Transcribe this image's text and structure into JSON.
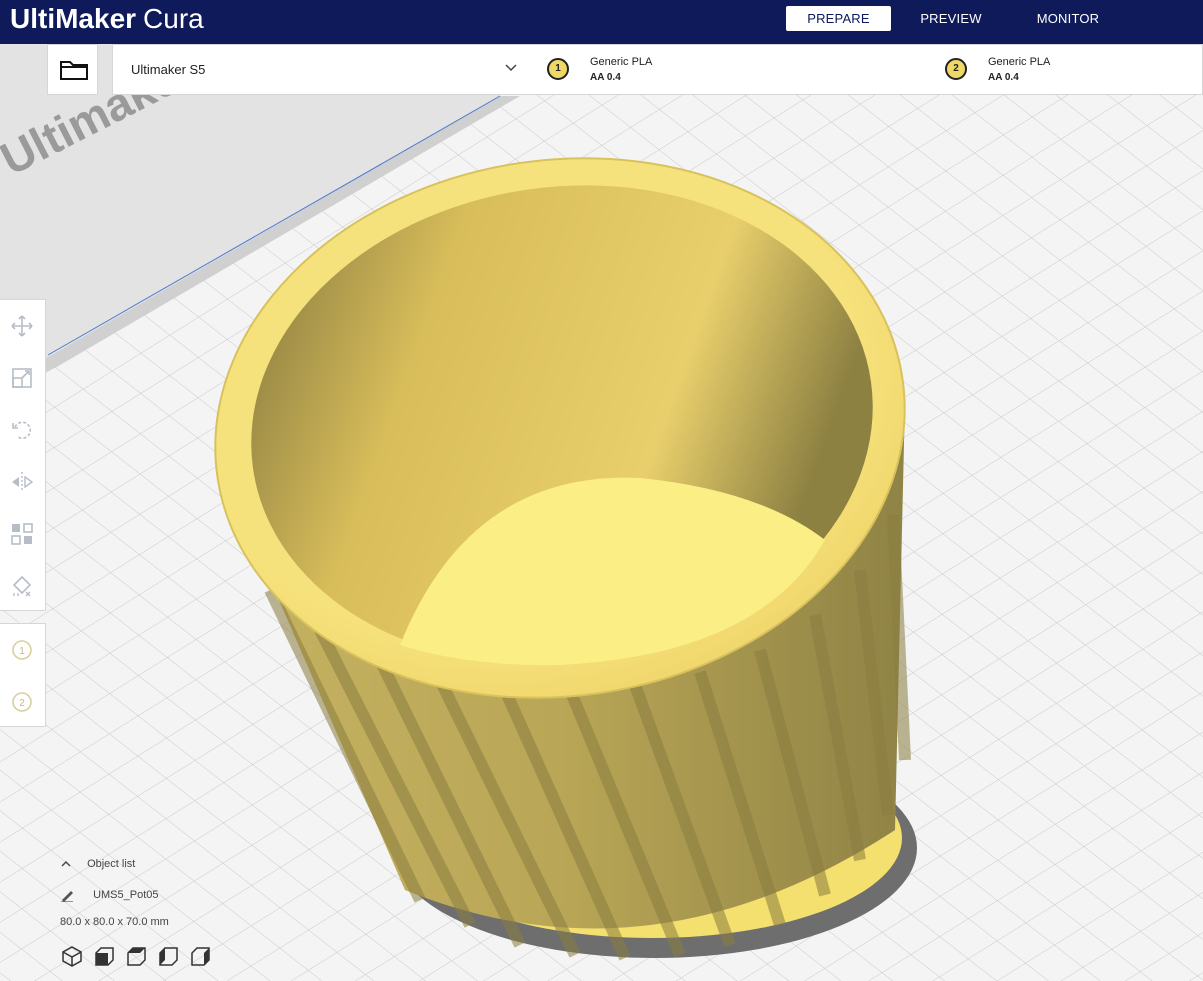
{
  "app": {
    "brand_bold": "UltiMaker",
    "brand_light": "Cura"
  },
  "tabs": [
    {
      "label": "PREPARE",
      "active": true
    },
    {
      "label": "PREVIEW",
      "active": false
    },
    {
      "label": "MONITOR",
      "active": false
    }
  ],
  "printer": {
    "name": "Ultimaker S5"
  },
  "extruders": [
    {
      "number": "1",
      "material": "Generic PLA",
      "nozzle": "AA 0.4"
    },
    {
      "number": "2",
      "material": "Generic PLA",
      "nozzle": "AA 0.4"
    }
  ],
  "build_plate": {
    "watermark": "Ultimaker"
  },
  "left_toolbar": {
    "tools": [
      "move-icon",
      "scale-icon",
      "rotate-icon",
      "mirror-icon",
      "per-model-settings-icon",
      "support-blocker-icon"
    ],
    "extruder_buttons": [
      "1",
      "2"
    ]
  },
  "object_panel": {
    "header": "Object list",
    "object_name": "UMS5_Pot05",
    "dimensions": "80.0 x 80.0 x 70.0 mm"
  },
  "view_buttons": [
    "3d-view-icon",
    "front-view-icon",
    "top-view-icon",
    "left-view-icon",
    "right-view-icon"
  ],
  "colors": {
    "topbar": "#0e1a5a",
    "model": "#f4e17a",
    "extruder_badge": "#f0d867"
  }
}
